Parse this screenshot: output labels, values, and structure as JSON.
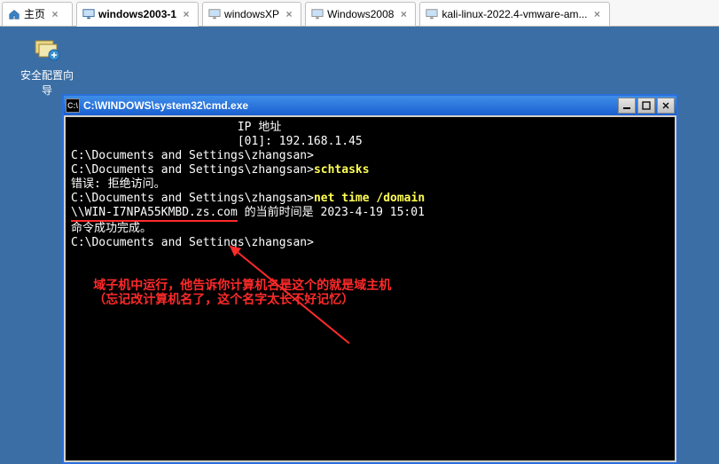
{
  "tabs": {
    "home": "主页",
    "t1": "windows2003-1",
    "t2": "windowsXP",
    "t3": "Windows2008",
    "t4": "kali-linux-2022.4-vmware-am..."
  },
  "desktop": {
    "label": "安全配置向导"
  },
  "cmd": {
    "title": "C:\\WINDOWS\\system32\\cmd.exe",
    "ico": "C:\\",
    "lines": {
      "l0": "                        IP 地址",
      "l1": "                        [01]: 192.168.1.45",
      "l2": "",
      "l3": "C:\\Documents and Settings\\zhangsan>",
      "l4a": "C:\\Documents and Settings\\zhangsan>",
      "l4b": "schtasks",
      "l5": "错误: 拒绝访问。",
      "l6": "",
      "l7a": "C:\\Documents and Settings\\zhangsan>",
      "l7b": "net time /domain",
      "l8a": "\\\\WIN-I7NPA55KMBD.zs.com",
      "l8b": " 的当前时间是 2023-4-19 15:01",
      "l9": "",
      "l10": "命令成功完成。",
      "l11": "",
      "l12": "",
      "l13": "C:\\Documents and Settings\\zhangsan>",
      "ann1": "   域子机中运行，他告诉你计算机名是这个的就是域主机",
      "ann2": "   （忘记改计算机名了，这个名字太长不好记忆）"
    }
  }
}
